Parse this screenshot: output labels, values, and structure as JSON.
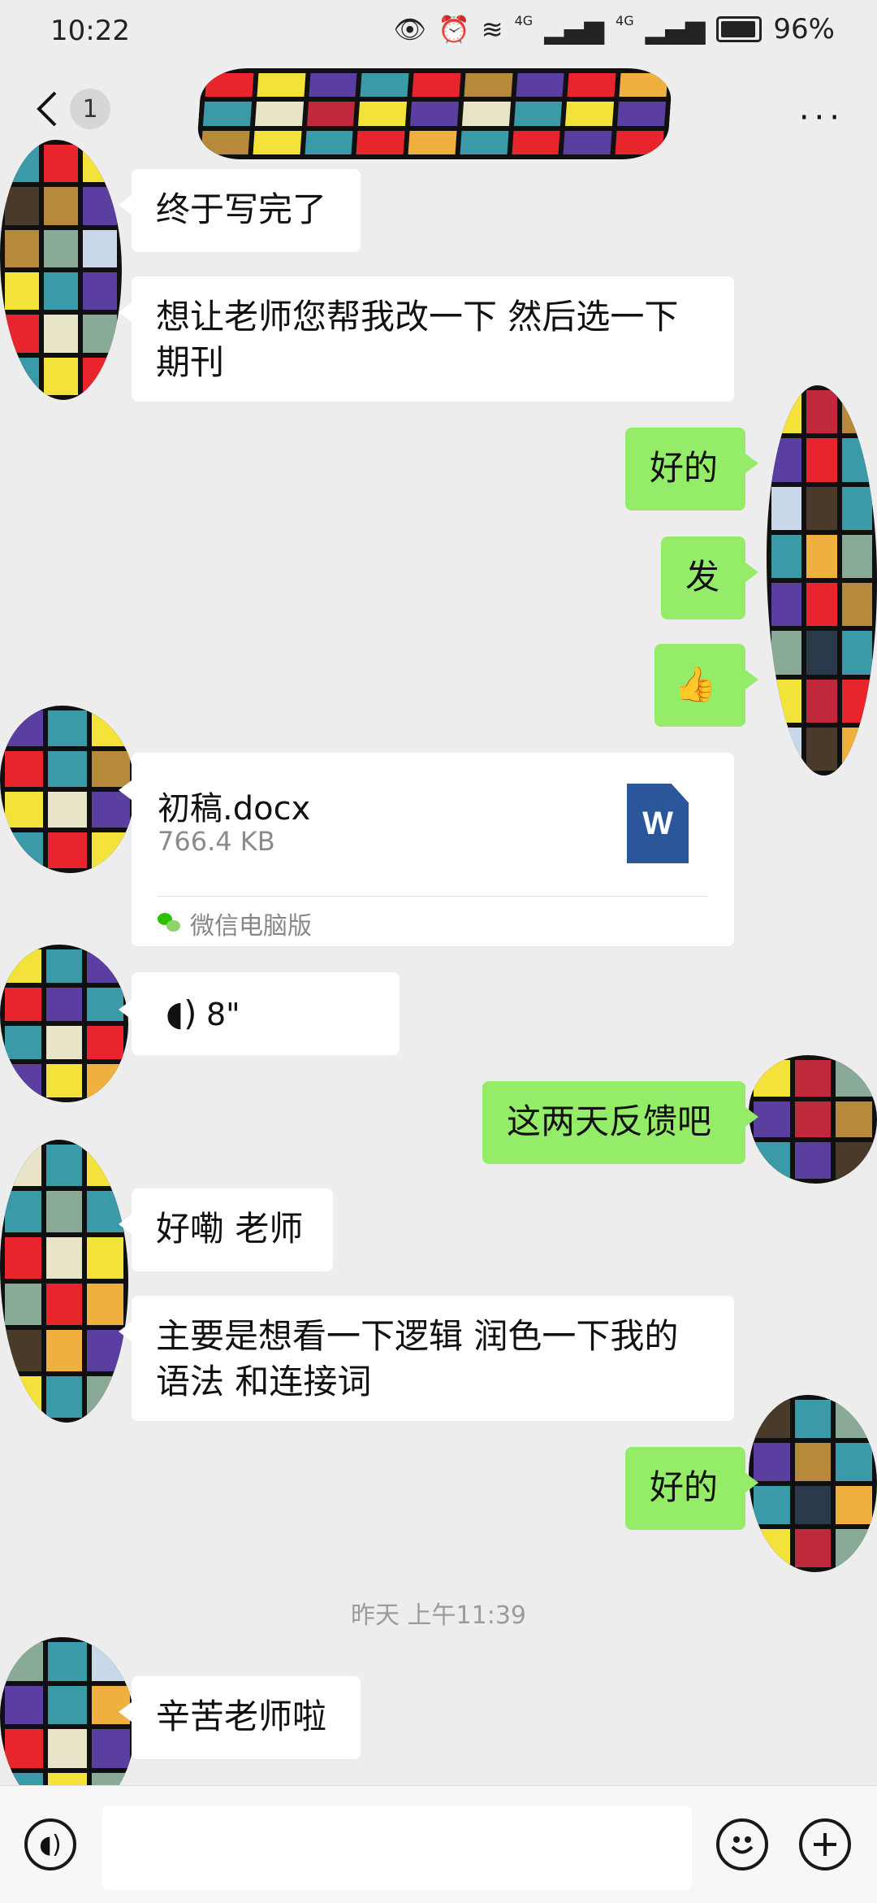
{
  "status_bar": {
    "time": "10:22",
    "network_1": "4G",
    "network_2": "4G",
    "battery": "96%"
  },
  "header": {
    "unread_count": "1",
    "more_label": "···"
  },
  "messages": {
    "m1": "终于写完了",
    "m2_line1": "想让老师您帮我改一下  然后选一下",
    "m2_line2": "期刊",
    "m3": "好的",
    "m4": "发",
    "m5": "👍",
    "file_name": "初稿.docx",
    "file_size": "766.4 KB",
    "file_icon_letter": "W",
    "file_source": "微信电脑版",
    "voice_duration": "8\"",
    "m6": "这两天反馈吧",
    "m7": "好嘞 老师",
    "m8_line1": "主要是想看一下逻辑 润色一下我的",
    "m8_line2": "语法 和连接词",
    "m9": "好的",
    "timestamp": "昨天 上午11:39",
    "m10": "辛苦老师啦"
  },
  "input_bar": {
    "text_value": ""
  },
  "colors": {
    "background": "#ededed",
    "outgoing_bubble": "#95ec69",
    "incoming_bubble": "#ffffff",
    "word_blue": "#2b579a"
  },
  "icons": {
    "back": "chevron-left-icon",
    "more": "more-dots-icon",
    "file": "word-doc-icon",
    "voice": "voice-wave-icon",
    "voice_input": "voice-input-icon",
    "emoji": "emoji-icon",
    "add": "plus-icon"
  }
}
